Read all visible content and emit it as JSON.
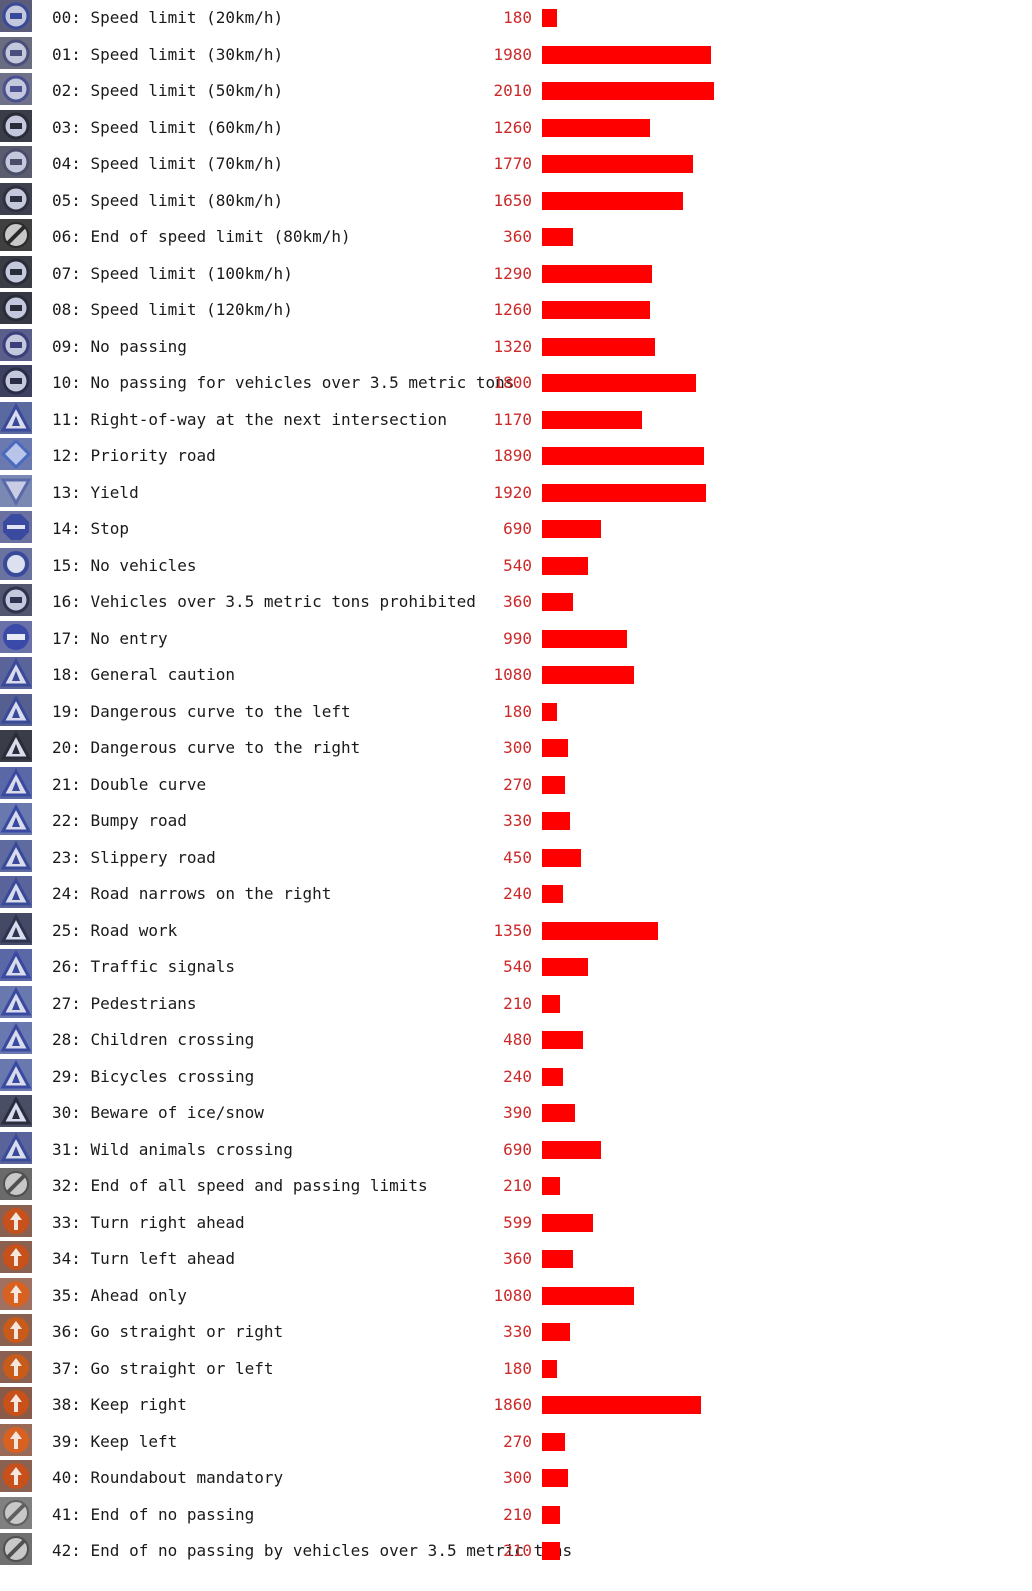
{
  "colors": {
    "bar": "#ff0000",
    "count_text": "#cc2a2a",
    "label_text": "#1a1a1a"
  },
  "chart_data": {
    "type": "bar",
    "orientation": "horizontal",
    "title": "",
    "xlabel": "",
    "ylabel": "",
    "xlim": [
      0,
      2010
    ],
    "grid": false,
    "legend": "none",
    "categories": [
      "00: Speed limit (20km/h)",
      "01: Speed limit (30km/h)",
      "02: Speed limit (50km/h)",
      "03: Speed limit (60km/h)",
      "04: Speed limit (70km/h)",
      "05: Speed limit (80km/h)",
      "06: End of speed limit (80km/h)",
      "07: Speed limit (100km/h)",
      "08: Speed limit (120km/h)",
      "09: No passing",
      "10: No passing for vehicles over 3.5 metric tons",
      "11: Right-of-way at the next intersection",
      "12: Priority road",
      "13: Yield",
      "14: Stop",
      "15: No vehicles",
      "16: Vehicles over 3.5 metric tons prohibited",
      "17: No entry",
      "18: General caution",
      "19: Dangerous curve to the left",
      "20: Dangerous curve to the right",
      "21: Double curve",
      "22: Bumpy road",
      "23: Slippery road",
      "24: Road narrows on the right",
      "25: Road work",
      "26: Traffic signals",
      "27: Pedestrians",
      "28: Children crossing",
      "29: Bicycles crossing",
      "30: Beware of ice/snow",
      "31: Wild animals crossing",
      "32: End of all speed and passing limits",
      "33: Turn right ahead",
      "34: Turn left ahead",
      "35: Ahead only",
      "36: Go straight or right",
      "37: Go straight or left",
      "38: Keep right",
      "39: Keep left",
      "40: Roundabout mandatory",
      "41: End of no passing",
      "42: End of no passing by vehicles over 3.5 metric tons"
    ],
    "values": [
      180,
      1980,
      2010,
      1260,
      1770,
      1650,
      360,
      1290,
      1260,
      1320,
      1800,
      1170,
      1890,
      1920,
      690,
      540,
      360,
      990,
      1080,
      180,
      300,
      270,
      330,
      450,
      240,
      1350,
      540,
      210,
      480,
      240,
      390,
      690,
      210,
      599,
      360,
      1080,
      330,
      180,
      1860,
      270,
      300,
      210,
      210
    ],
    "value_labels": [
      "180",
      "1980",
      "2010",
      "1260",
      "1770",
      "1650",
      "360",
      "1290",
      "1260",
      "1320",
      "1800",
      "1170",
      "1890",
      "1920",
      "690",
      "540",
      "360",
      "990",
      "1080",
      "180",
      "300",
      "270",
      "330",
      "450",
      "240",
      "1350",
      "540",
      "210",
      "480",
      "240",
      "390",
      "690",
      "210",
      "599",
      "360",
      "1080",
      "330",
      "180",
      "1860",
      "270",
      "300",
      "210",
      "210"
    ],
    "thumbnails": [
      {
        "icon": "speed-limit-20-sign-icon",
        "shape": "circle",
        "fg": "#3a4a9a",
        "bg": "#5a5c7a"
      },
      {
        "icon": "speed-limit-30-sign-icon",
        "shape": "circle",
        "fg": "#4a4e7a",
        "bg": "#6a6c80"
      },
      {
        "icon": "speed-limit-50-sign-icon",
        "shape": "circle",
        "fg": "#4a5090",
        "bg": "#70728a"
      },
      {
        "icon": "speed-limit-60-sign-icon",
        "shape": "circle",
        "fg": "#2a2c3a",
        "bg": "#3a3c48"
      },
      {
        "icon": "speed-limit-70-sign-icon",
        "shape": "circle",
        "fg": "#4a4c6a",
        "bg": "#5a5c6e"
      },
      {
        "icon": "speed-limit-80-sign-icon",
        "shape": "circle",
        "fg": "#2e3040",
        "bg": "#3e4050"
      },
      {
        "icon": "end-speed-limit-80-sign-icon",
        "shape": "slash",
        "fg": "#2a2a2a",
        "bg": "#404040"
      },
      {
        "icon": "speed-limit-100-sign-icon",
        "shape": "circle",
        "fg": "#2a2c38",
        "bg": "#3a3c46"
      },
      {
        "icon": "speed-limit-120-sign-icon",
        "shape": "circle",
        "fg": "#2a2c38",
        "bg": "#363844"
      },
      {
        "icon": "no-passing-sign-icon",
        "shape": "circle",
        "fg": "#3a3e7a",
        "bg": "#5a5e8a"
      },
      {
        "icon": "no-passing-trucks-sign-icon",
        "shape": "circle",
        "fg": "#2a2c48",
        "bg": "#3e4060"
      },
      {
        "icon": "right-of-way-sign-icon",
        "shape": "triangle",
        "fg": "#3a4a9a",
        "bg": "#5a6aa0"
      },
      {
        "icon": "priority-road-sign-icon",
        "shape": "diamond",
        "fg": "#4a6ac0",
        "bg": "#6a7ab0"
      },
      {
        "icon": "yield-sign-icon",
        "shape": "inverted-triangle",
        "fg": "#5a6aa8",
        "bg": "#7a88b4"
      },
      {
        "icon": "stop-sign-icon",
        "shape": "stop",
        "fg": "#3a4aa0",
        "bg": "#6a70a0"
      },
      {
        "icon": "no-vehicles-sign-icon",
        "shape": "ring",
        "fg": "#3a4a9a",
        "bg": "#6a72a0"
      },
      {
        "icon": "trucks-prohibited-sign-icon",
        "shape": "circle",
        "fg": "#2e3450",
        "bg": "#52566e"
      },
      {
        "icon": "no-entry-sign-icon",
        "shape": "bar-circle",
        "fg": "#3a4aa8",
        "bg": "#6a70a8"
      },
      {
        "icon": "general-caution-sign-icon",
        "shape": "triangle",
        "fg": "#3a4a9a",
        "bg": "#5a649a"
      },
      {
        "icon": "curve-left-sign-icon",
        "shape": "triangle",
        "fg": "#3a4a9a",
        "bg": "#566090"
      },
      {
        "icon": "curve-right-sign-icon",
        "shape": "triangle",
        "fg": "#2a2c38",
        "bg": "#3a3c48"
      },
      {
        "icon": "double-curve-sign-icon",
        "shape": "triangle",
        "fg": "#3a4aa0",
        "bg": "#5a68a8"
      },
      {
        "icon": "bumpy-road-sign-icon",
        "shape": "triangle",
        "fg": "#3a4aa0",
        "bg": "#6a78b0"
      },
      {
        "icon": "slippery-road-sign-icon",
        "shape": "triangle",
        "fg": "#3a4a9a",
        "bg": "#5e6aa0"
      },
      {
        "icon": "road-narrows-sign-icon",
        "shape": "triangle",
        "fg": "#3a4a9a",
        "bg": "#5a649a"
      },
      {
        "icon": "road-work-sign-icon",
        "shape": "triangle",
        "fg": "#2e3450",
        "bg": "#444a66"
      },
      {
        "icon": "traffic-signals-sign-icon",
        "shape": "triangle",
        "fg": "#3a4aa0",
        "bg": "#5a68a8"
      },
      {
        "icon": "pedestrians-sign-icon",
        "shape": "triangle",
        "fg": "#3a4aa0",
        "bg": "#6a78b0"
      },
      {
        "icon": "children-crossing-sign-icon",
        "shape": "triangle",
        "fg": "#3a4aa0",
        "bg": "#6a78b0"
      },
      {
        "icon": "bicycles-crossing-sign-icon",
        "shape": "triangle",
        "fg": "#3a4aa0",
        "bg": "#6a78b0"
      },
      {
        "icon": "ice-snow-sign-icon",
        "shape": "triangle",
        "fg": "#2a2c40",
        "bg": "#4a4e64"
      },
      {
        "icon": "wild-animals-sign-icon",
        "shape": "triangle",
        "fg": "#3a4a9a",
        "bg": "#5a649a"
      },
      {
        "icon": "end-all-limits-sign-icon",
        "shape": "slash",
        "fg": "#505050",
        "bg": "#6a6a6a"
      },
      {
        "icon": "turn-right-ahead-sign-icon",
        "shape": "arrow",
        "fg": "#c8501a",
        "bg": "#8a6050"
      },
      {
        "icon": "turn-left-ahead-sign-icon",
        "shape": "arrow",
        "fg": "#c8501a",
        "bg": "#8a6050"
      },
      {
        "icon": "ahead-only-sign-icon",
        "shape": "arrow",
        "fg": "#d86020",
        "bg": "#a07060"
      },
      {
        "icon": "straight-or-right-sign-icon",
        "shape": "arrow",
        "fg": "#c85a1a",
        "bg": "#8a6050"
      },
      {
        "icon": "straight-or-left-sign-icon",
        "shape": "arrow",
        "fg": "#c85a1a",
        "bg": "#8a6050"
      },
      {
        "icon": "keep-right-sign-icon",
        "shape": "arrow",
        "fg": "#c8501a",
        "bg": "#8a5a48"
      },
      {
        "icon": "keep-left-sign-icon",
        "shape": "arrow",
        "fg": "#d86020",
        "bg": "#9a6a58"
      },
      {
        "icon": "roundabout-sign-icon",
        "shape": "arrow",
        "fg": "#c8501a",
        "bg": "#8a6050"
      },
      {
        "icon": "end-no-passing-sign-icon",
        "shape": "slash",
        "fg": "#606060",
        "bg": "#808080"
      },
      {
        "icon": "end-no-passing-trucks-sign-icon",
        "shape": "slash",
        "fg": "#505050",
        "bg": "#707070"
      }
    ]
  }
}
